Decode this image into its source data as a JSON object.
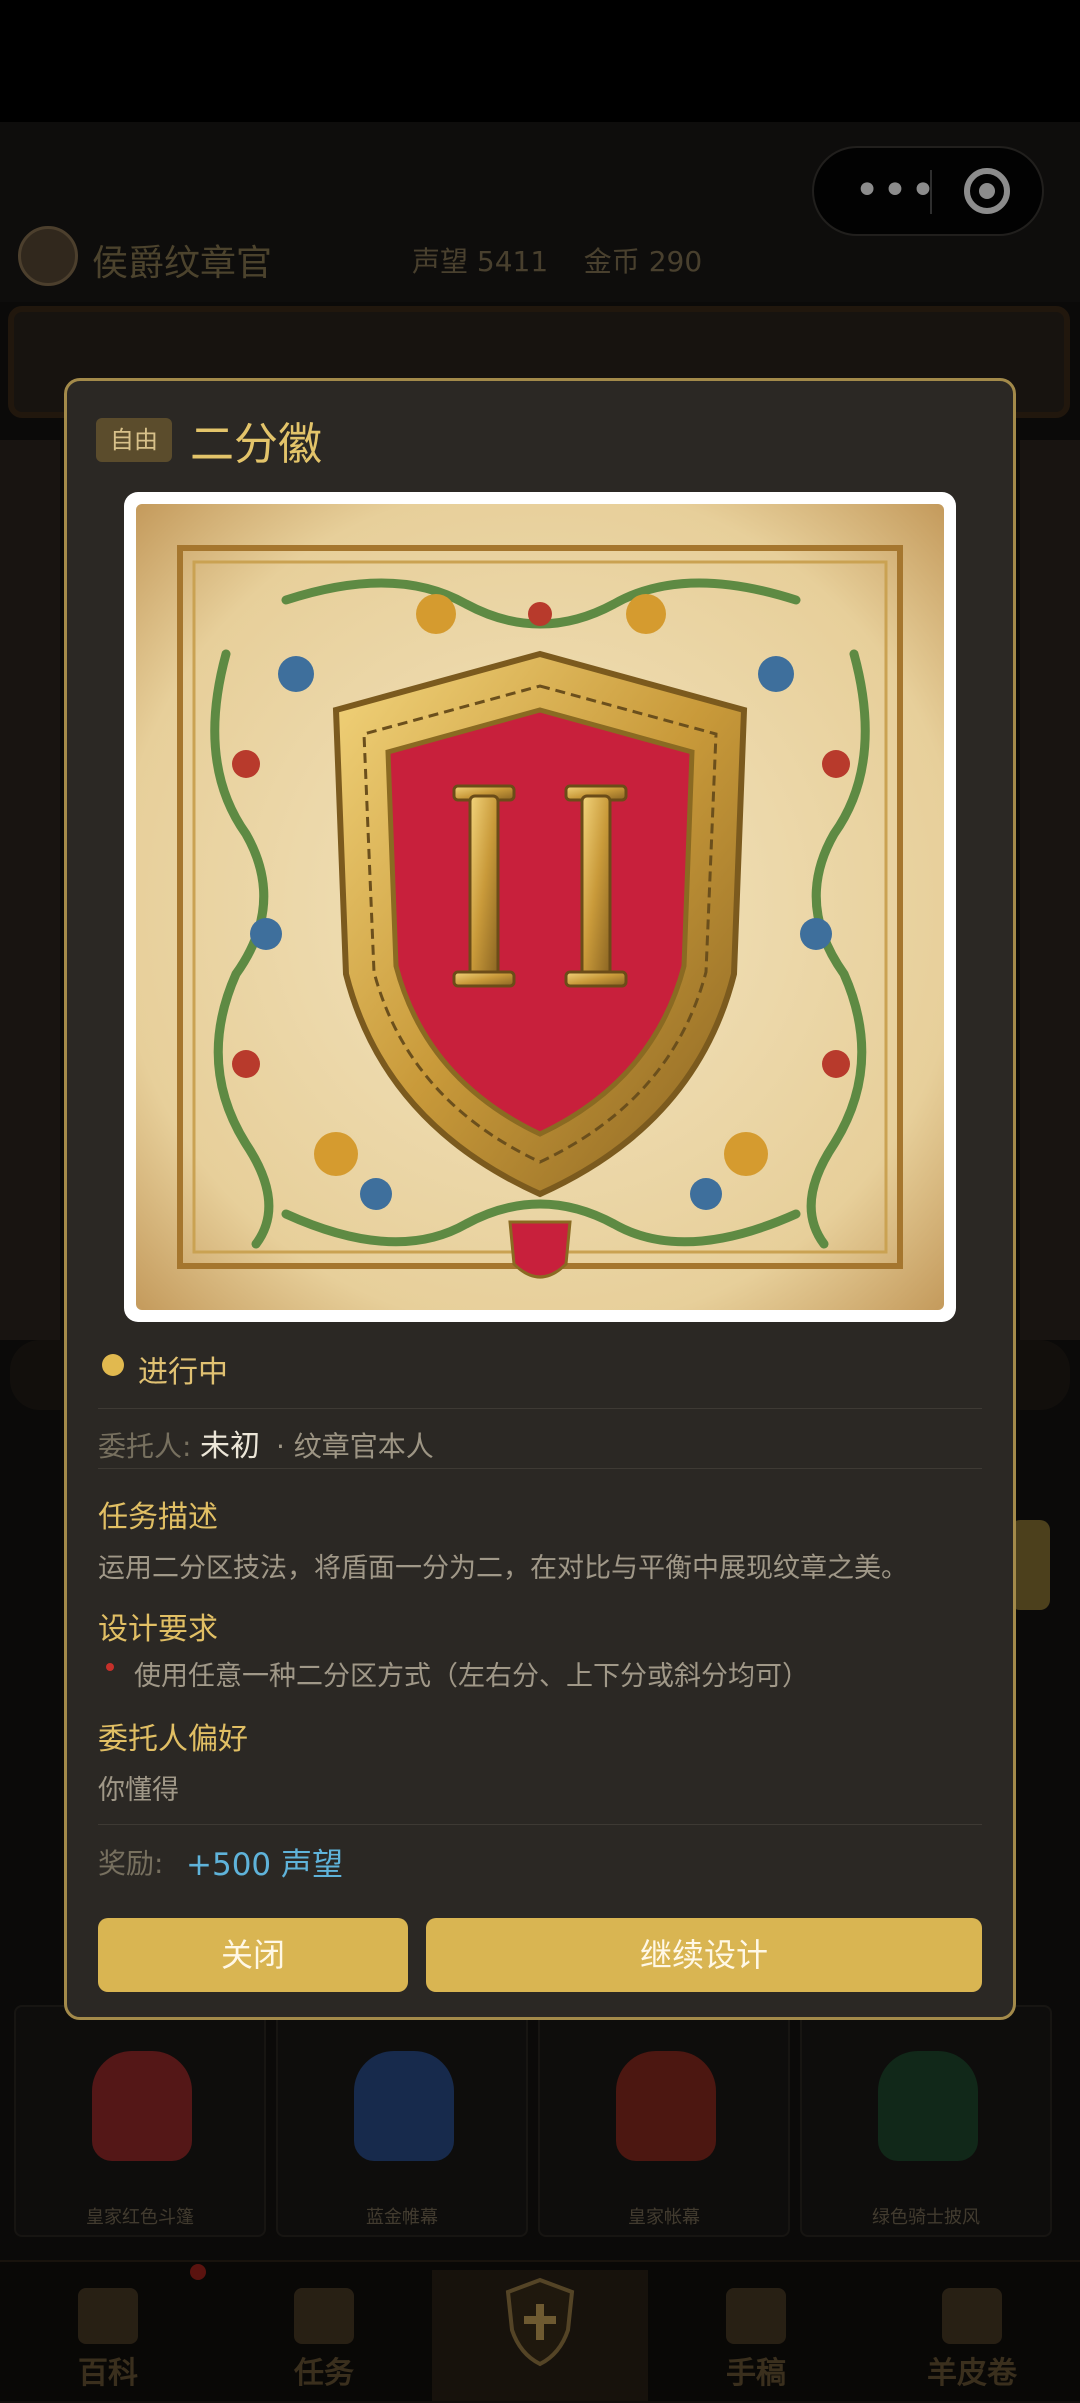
{
  "header": {
    "app_name": "侯爵纹章官",
    "reputation_label": "声望",
    "reputation_value": "5411",
    "gold_label": "金币",
    "gold_value": "290",
    "more_icon": "more-dots-icon",
    "capsule_icon": "target-icon"
  },
  "modal": {
    "tag": "自由",
    "title": "二分徽",
    "status": "进行中",
    "client_label": "委托人:",
    "client_name": "未初",
    "client_role": "· 纹章官本人",
    "description_title": "任务描述",
    "description": "运用二分区技法，将盾面一分为二，在对比与平衡中展现纹章之美。",
    "requirements_title": "设计要求",
    "requirements": [
      "使用任意一种二分区方式（左右分、上下分或斜分均可）"
    ],
    "preference_title": "委托人偏好",
    "preference": "你懂得",
    "reward_label": "奖励:",
    "reward_value": "+500 声望",
    "close_label": "关闭",
    "continue_label": "继续设计"
  },
  "shop_items": [
    {
      "label": "皇家红色斗篷",
      "color": "#9a2a2a"
    },
    {
      "label": "蓝金帷幕",
      "color": "#2b4d8a"
    },
    {
      "label": "皇家帐幕",
      "color": "#8a2a20"
    },
    {
      "label": "绿色骑士披风",
      "color": "#1f4a2e"
    }
  ],
  "nav": [
    {
      "label": "百科",
      "icon": "book-icon"
    },
    {
      "label": "任务",
      "icon": "scroll-list-icon"
    },
    {
      "label": "",
      "icon": "shield-cross-icon"
    },
    {
      "label": "手稿",
      "icon": "quill-icon"
    },
    {
      "label": "羊皮卷",
      "icon": "parchment-icon"
    }
  ],
  "colors": {
    "accent_gold": "#d9b552",
    "modal_bg": "#2b2824",
    "reward_blue": "#5fb3da",
    "shield_red": "#c8203c"
  }
}
